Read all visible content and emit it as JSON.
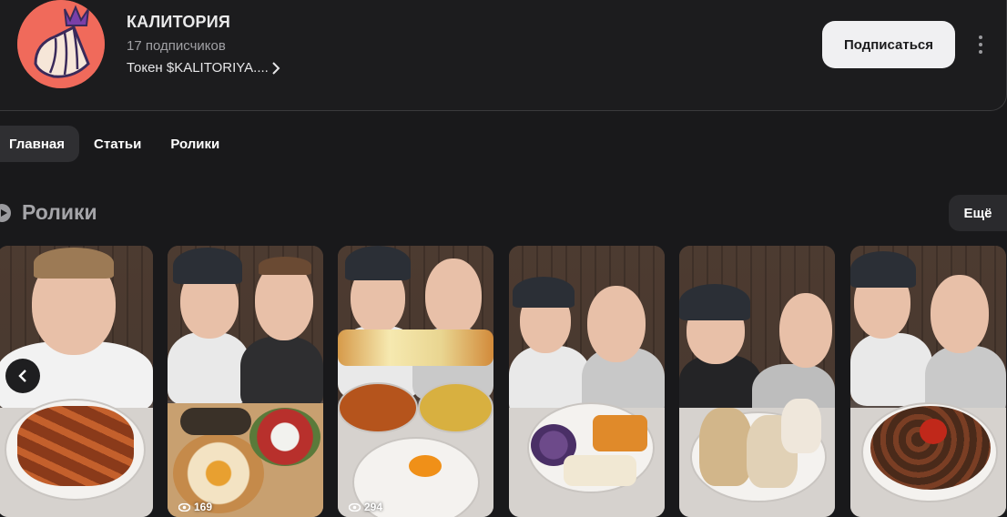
{
  "channel": {
    "name": "КАЛИТОРИЯ",
    "subscribers": "17 подписчиков",
    "token_label": "Токен $KALITORIYA....",
    "subscribe_label": "Подписаться",
    "avatar_icon": "dumpling-crown-logo"
  },
  "tabs": [
    {
      "label": "Главная",
      "active": true
    },
    {
      "label": "Статьи",
      "active": false
    },
    {
      "label": "Ролики",
      "active": false
    }
  ],
  "section": {
    "title": "Ролики",
    "icon": "play-circle-icon",
    "more_label": "Ещё"
  },
  "videos": [
    {
      "subject": "sausages",
      "views": ""
    },
    {
      "subject": "eggplant-khachapuri",
      "views": "169"
    },
    {
      "subject": "cheese-pull-soups",
      "views": "294"
    },
    {
      "subject": "fruit-platter",
      "views": ""
    },
    {
      "subject": "khinkali",
      "views": ""
    },
    {
      "subject": "shashlik",
      "views": ""
    }
  ],
  "colors": {
    "background": "#19191b",
    "subscribe_bg": "#f0f0f2",
    "avatar_bg": "#f06a5b"
  }
}
